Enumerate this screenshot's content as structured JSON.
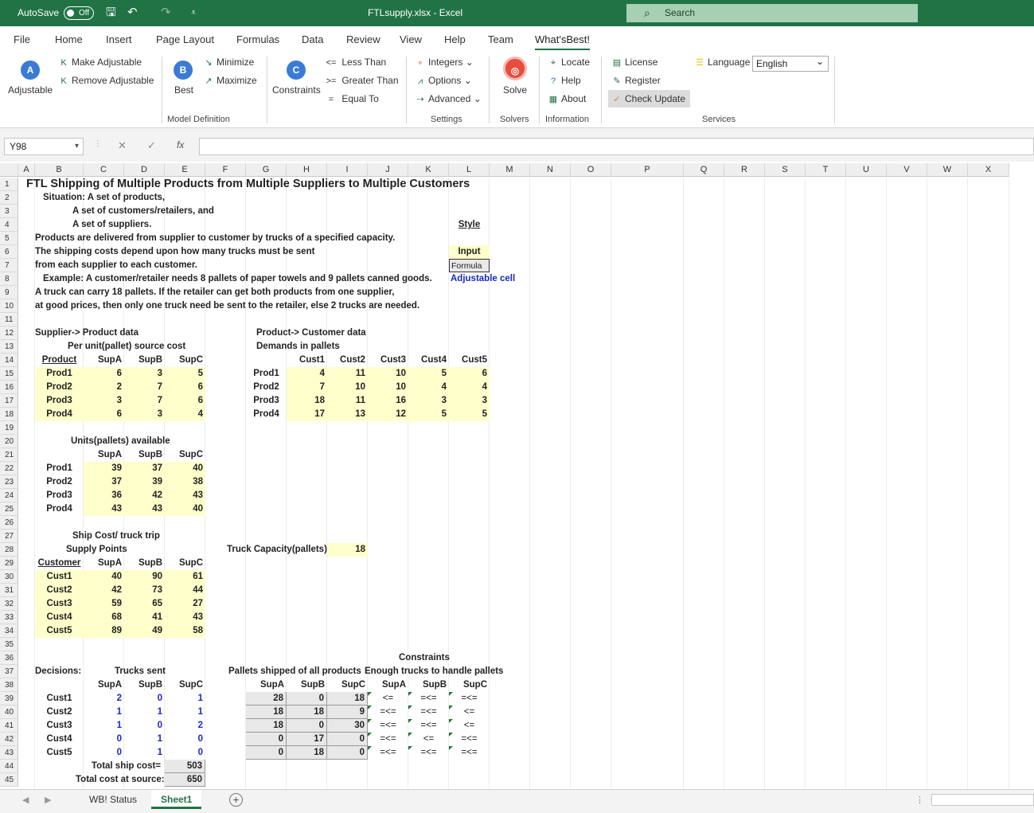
{
  "titlebar": {
    "autosave_label": "AutoSave",
    "autosave_state": "Off",
    "document_title": "FTLsupply.xlsx  -  Excel",
    "search_placeholder": "Search"
  },
  "tabs": [
    "File",
    "Home",
    "Insert",
    "Page Layout",
    "Formulas",
    "Data",
    "Review",
    "View",
    "Help",
    "Team",
    "What'sBest!"
  ],
  "ribbon": {
    "adjustable": "Adjustable",
    "make_adjustable": "Make Adjustable",
    "remove_adjustable": "Remove Adjustable",
    "best": "Best",
    "minimize": "Minimize",
    "maximize": "Maximize",
    "constraints": "Constraints",
    "less_than": "Less Than",
    "greater_than": "Greater Than",
    "equal_to": "Equal To",
    "integers": "Integers",
    "options": "Options",
    "advanced": "Advanced",
    "solve": "Solve",
    "locate": "Locate",
    "help": "Help",
    "about": "About",
    "license": "License",
    "register": "Register",
    "check_update": "Check Update",
    "language_label": "Language",
    "language_value": "English",
    "groups": {
      "model_definition": "Model Definition",
      "settings": "Settings",
      "solvers": "Solvers",
      "information": "Information",
      "services": "Services"
    }
  },
  "formula_bar": {
    "name_box": "Y98",
    "formula": ""
  },
  "columns": [
    "A",
    "B",
    "C",
    "D",
    "E",
    "F",
    "G",
    "H",
    "I",
    "J",
    "K",
    "L",
    "M",
    "N",
    "O",
    "P",
    "Q",
    "R",
    "S",
    "T",
    "U",
    "V",
    "W",
    "X"
  ],
  "cells": [
    {
      "r": 1,
      "c": "A",
      "t": "FTL Shipping of Multiple Products from Multiple Suppliers to Multiple Customers",
      "cls": "title"
    },
    {
      "r": 2,
      "c": "B",
      "t": "Situation: A set of products,",
      "o": 10
    },
    {
      "r": 3,
      "c": "C",
      "t": "A set of customers/retailers, and",
      "o": -14
    },
    {
      "r": 4,
      "c": "C",
      "t": "A set of  suppliers.",
      "o": -14
    },
    {
      "r": 4,
      "c": "L",
      "t": "Style",
      "cls": "u c"
    },
    {
      "r": 5,
      "c": "B",
      "t": "Products are delivered from supplier to customer by trucks of a specified capacity."
    },
    {
      "r": 6,
      "c": "B",
      "t": "The shipping costs depend upon how many trucks must be sent"
    },
    {
      "r": 6,
      "c": "L",
      "t": "Input",
      "cls": "c inp"
    },
    {
      "r": 7,
      "c": "B",
      "t": "from each supplier to each customer."
    },
    {
      "r": 7,
      "c": "L",
      "t": "Formula",
      "cls": "frm formula"
    },
    {
      "r": 8,
      "c": "B",
      "t": "Example: A customer/retailer needs 8 pallets of paper towels and 9 pallets canned goods.",
      "o": 10
    },
    {
      "r": 8,
      "c": "L",
      "t": "Adjustable cell",
      "cls": "blue"
    },
    {
      "r": 9,
      "c": "B",
      "t": "A truck can carry 18 pallets.  If the retailer can get both products from one supplier,"
    },
    {
      "r": 10,
      "c": "B",
      "t": "at good prices, then only one truck need be sent to the retailer, else 2 trucks are needed."
    },
    {
      "r": 12,
      "c": "B",
      "t": "Supplier-> Product data"
    },
    {
      "r": 12,
      "c": "H",
      "t": "Product-> Customer data",
      "o": -38
    },
    {
      "r": 13,
      "c": "C",
      "t": "Per unit(pallet) source cost",
      "o": -20
    },
    {
      "r": 13,
      "c": "H",
      "t": "Demands in pallets",
      "o": -38
    },
    {
      "r": 14,
      "c": "B",
      "t": "Product",
      "cls": "u c"
    },
    {
      "r": 14,
      "c": "C",
      "t": "SupA",
      "cls": "r"
    },
    {
      "r": 14,
      "c": "D",
      "t": "SupB",
      "cls": "r"
    },
    {
      "r": 14,
      "c": "E",
      "t": "SupC",
      "cls": "r"
    },
    {
      "r": 14,
      "c": "H",
      "t": "Cust1",
      "cls": "r"
    },
    {
      "r": 14,
      "c": "I",
      "t": "Cust2",
      "cls": "r"
    },
    {
      "r": 14,
      "c": "J",
      "t": "Cust3",
      "cls": "r"
    },
    {
      "r": 14,
      "c": "K",
      "t": "Cust4",
      "cls": "r"
    },
    {
      "r": 14,
      "c": "L",
      "t": "Cust5",
      "cls": "r"
    },
    {
      "r": 15,
      "c": "B",
      "t": "Prod1",
      "cls": "c inp"
    },
    {
      "r": 15,
      "c": "C",
      "t": "6",
      "cls": "r inp"
    },
    {
      "r": 15,
      "c": "D",
      "t": "3",
      "cls": "r inp"
    },
    {
      "r": 15,
      "c": "E",
      "t": "5",
      "cls": "r inp"
    },
    {
      "r": 16,
      "c": "B",
      "t": "Prod2",
      "cls": "c inp"
    },
    {
      "r": 16,
      "c": "C",
      "t": "2",
      "cls": "r inp"
    },
    {
      "r": 16,
      "c": "D",
      "t": "7",
      "cls": "r inp"
    },
    {
      "r": 16,
      "c": "E",
      "t": "6",
      "cls": "r inp"
    },
    {
      "r": 17,
      "c": "B",
      "t": "Prod3",
      "cls": "c inp"
    },
    {
      "r": 17,
      "c": "C",
      "t": "3",
      "cls": "r inp"
    },
    {
      "r": 17,
      "c": "D",
      "t": "7",
      "cls": "r inp"
    },
    {
      "r": 17,
      "c": "E",
      "t": "6",
      "cls": "r inp"
    },
    {
      "r": 18,
      "c": "B",
      "t": "Prod4",
      "cls": "c inp"
    },
    {
      "r": 18,
      "c": "C",
      "t": "6",
      "cls": "r inp"
    },
    {
      "r": 18,
      "c": "D",
      "t": "3",
      "cls": "r inp"
    },
    {
      "r": 18,
      "c": "E",
      "t": "4",
      "cls": "r inp"
    },
    {
      "r": 15,
      "c": "G",
      "t": "Prod1",
      "cls": "c"
    },
    {
      "r": 16,
      "c": "G",
      "t": "Prod2",
      "cls": "c"
    },
    {
      "r": 17,
      "c": "G",
      "t": "Prod3",
      "cls": "c"
    },
    {
      "r": 18,
      "c": "G",
      "t": "Prod4",
      "cls": "c"
    },
    {
      "r": 15,
      "c": "H",
      "t": "4",
      "cls": "r inp"
    },
    {
      "r": 15,
      "c": "I",
      "t": "11",
      "cls": "r inp"
    },
    {
      "r": 15,
      "c": "J",
      "t": "10",
      "cls": "r inp"
    },
    {
      "r": 15,
      "c": "K",
      "t": "5",
      "cls": "r inp"
    },
    {
      "r": 15,
      "c": "L",
      "t": "6",
      "cls": "r inp"
    },
    {
      "r": 16,
      "c": "H",
      "t": "7",
      "cls": "r inp"
    },
    {
      "r": 16,
      "c": "I",
      "t": "10",
      "cls": "r inp"
    },
    {
      "r": 16,
      "c": "J",
      "t": "10",
      "cls": "r inp"
    },
    {
      "r": 16,
      "c": "K",
      "t": "4",
      "cls": "r inp"
    },
    {
      "r": 16,
      "c": "L",
      "t": "4",
      "cls": "r inp"
    },
    {
      "r": 17,
      "c": "H",
      "t": "18",
      "cls": "r inp"
    },
    {
      "r": 17,
      "c": "I",
      "t": "11",
      "cls": "r inp"
    },
    {
      "r": 17,
      "c": "J",
      "t": "16",
      "cls": "r inp"
    },
    {
      "r": 17,
      "c": "K",
      "t": "3",
      "cls": "r inp"
    },
    {
      "r": 17,
      "c": "L",
      "t": "3",
      "cls": "r inp"
    },
    {
      "r": 18,
      "c": "H",
      "t": "17",
      "cls": "r inp"
    },
    {
      "r": 18,
      "c": "I",
      "t": "13",
      "cls": "r inp"
    },
    {
      "r": 18,
      "c": "J",
      "t": "12",
      "cls": "r inp"
    },
    {
      "r": 18,
      "c": "K",
      "t": "5",
      "cls": "r inp"
    },
    {
      "r": 18,
      "c": "L",
      "t": "5",
      "cls": "r inp"
    },
    {
      "r": 20,
      "c": "C",
      "t": "Units(pallets) available",
      "o": -16
    },
    {
      "r": 21,
      "c": "C",
      "t": "SupA",
      "cls": "r"
    },
    {
      "r": 21,
      "c": "D",
      "t": "SupB",
      "cls": "r"
    },
    {
      "r": 21,
      "c": "E",
      "t": "SupC",
      "cls": "r"
    },
    {
      "r": 22,
      "c": "B",
      "t": "Prod1",
      "cls": "c"
    },
    {
      "r": 22,
      "c": "C",
      "t": "39",
      "cls": "r inp"
    },
    {
      "r": 22,
      "c": "D",
      "t": "37",
      "cls": "r inp"
    },
    {
      "r": 22,
      "c": "E",
      "t": "40",
      "cls": "r inp"
    },
    {
      "r": 23,
      "c": "B",
      "t": "Prod2",
      "cls": "c"
    },
    {
      "r": 23,
      "c": "C",
      "t": "37",
      "cls": "r inp"
    },
    {
      "r": 23,
      "c": "D",
      "t": "39",
      "cls": "r inp"
    },
    {
      "r": 23,
      "c": "E",
      "t": "38",
      "cls": "r inp"
    },
    {
      "r": 24,
      "c": "B",
      "t": "Prod3",
      "cls": "c"
    },
    {
      "r": 24,
      "c": "C",
      "t": "36",
      "cls": "r inp"
    },
    {
      "r": 24,
      "c": "D",
      "t": "42",
      "cls": "r inp"
    },
    {
      "r": 24,
      "c": "E",
      "t": "43",
      "cls": "r inp"
    },
    {
      "r": 25,
      "c": "B",
      "t": "Prod4",
      "cls": "c"
    },
    {
      "r": 25,
      "c": "C",
      "t": "43",
      "cls": "r inp"
    },
    {
      "r": 25,
      "c": "D",
      "t": "43",
      "cls": "r inp"
    },
    {
      "r": 25,
      "c": "E",
      "t": "40",
      "cls": "r inp"
    },
    {
      "r": 27,
      "c": "C",
      "t": "Ship Cost/ truck trip",
      "o": -14
    },
    {
      "r": 28,
      "c": "C",
      "t": "Supply Points",
      "o": -22
    },
    {
      "r": 28,
      "c": "G",
      "t": "Truck Capacity(pallets):",
      "o": -24
    },
    {
      "r": 28,
      "c": "I",
      "t": "18",
      "cls": "r inp"
    },
    {
      "r": 29,
      "c": "B",
      "t": "Customer",
      "cls": "u c"
    },
    {
      "r": 29,
      "c": "C",
      "t": "SupA",
      "cls": "r"
    },
    {
      "r": 29,
      "c": "D",
      "t": "SupB",
      "cls": "r"
    },
    {
      "r": 29,
      "c": "E",
      "t": "SupC",
      "cls": "r"
    },
    {
      "r": 30,
      "c": "B",
      "t": "Cust1",
      "cls": "c inp"
    },
    {
      "r": 30,
      "c": "C",
      "t": "40",
      "cls": "r inp"
    },
    {
      "r": 30,
      "c": "D",
      "t": "90",
      "cls": "r inp"
    },
    {
      "r": 30,
      "c": "E",
      "t": "61",
      "cls": "r inp"
    },
    {
      "r": 31,
      "c": "B",
      "t": "Cust2",
      "cls": "c inp"
    },
    {
      "r": 31,
      "c": "C",
      "t": "42",
      "cls": "r inp"
    },
    {
      "r": 31,
      "c": "D",
      "t": "73",
      "cls": "r inp"
    },
    {
      "r": 31,
      "c": "E",
      "t": "44",
      "cls": "r inp"
    },
    {
      "r": 32,
      "c": "B",
      "t": "Cust3",
      "cls": "c inp"
    },
    {
      "r": 32,
      "c": "C",
      "t": "59",
      "cls": "r inp"
    },
    {
      "r": 32,
      "c": "D",
      "t": "65",
      "cls": "r inp"
    },
    {
      "r": 32,
      "c": "E",
      "t": "27",
      "cls": "r inp"
    },
    {
      "r": 33,
      "c": "B",
      "t": "Cust4",
      "cls": "c inp"
    },
    {
      "r": 33,
      "c": "C",
      "t": "68",
      "cls": "r inp"
    },
    {
      "r": 33,
      "c": "D",
      "t": "41",
      "cls": "r inp"
    },
    {
      "r": 33,
      "c": "E",
      "t": "43",
      "cls": "r inp"
    },
    {
      "r": 34,
      "c": "B",
      "t": "Cust5",
      "cls": "c inp"
    },
    {
      "r": 34,
      "c": "C",
      "t": "89",
      "cls": "r inp"
    },
    {
      "r": 34,
      "c": "D",
      "t": "49",
      "cls": "r inp"
    },
    {
      "r": 34,
      "c": "E",
      "t": "58",
      "cls": "r inp"
    },
    {
      "r": 36,
      "c": "K",
      "t": "Constraints",
      "o": -12
    },
    {
      "r": 37,
      "c": "B",
      "t": "Decisions:"
    },
    {
      "r": 37,
      "c": "D",
      "t": "Trucks sent",
      "o": -12
    },
    {
      "r": 37,
      "c": "G",
      "t": "Pallets shipped of all products",
      "o": -22
    },
    {
      "r": 37,
      "c": "J",
      "t": "Enough trucks to handle pallets",
      "o": -4
    },
    {
      "r": 38,
      "c": "C",
      "t": "SupA",
      "cls": "r"
    },
    {
      "r": 38,
      "c": "D",
      "t": "SupB",
      "cls": "r"
    },
    {
      "r": 38,
      "c": "E",
      "t": "SupC",
      "cls": "r"
    },
    {
      "r": 38,
      "c": "G",
      "t": "SupA",
      "cls": "r"
    },
    {
      "r": 38,
      "c": "H",
      "t": "SupB",
      "cls": "r"
    },
    {
      "r": 38,
      "c": "I",
      "t": "SupC",
      "cls": "r"
    },
    {
      "r": 38,
      "c": "J",
      "t": "SupA",
      "cls": "r"
    },
    {
      "r": 38,
      "c": "K",
      "t": "SupB",
      "cls": "r"
    },
    {
      "r": 38,
      "c": "L",
      "t": "SupC",
      "cls": "r"
    },
    {
      "r": 39,
      "c": "B",
      "t": "Cust1",
      "cls": "c"
    },
    {
      "r": 39,
      "c": "C",
      "t": "2",
      "cls": "r blue"
    },
    {
      "r": 39,
      "c": "D",
      "t": "0",
      "cls": "r blue"
    },
    {
      "r": 39,
      "c": "E",
      "t": "1",
      "cls": "r blue"
    },
    {
      "r": 40,
      "c": "B",
      "t": "Cust2",
      "cls": "c"
    },
    {
      "r": 40,
      "c": "C",
      "t": "1",
      "cls": "r blue"
    },
    {
      "r": 40,
      "c": "D",
      "t": "1",
      "cls": "r blue"
    },
    {
      "r": 40,
      "c": "E",
      "t": "1",
      "cls": "r blue"
    },
    {
      "r": 41,
      "c": "B",
      "t": "Cust3",
      "cls": "c"
    },
    {
      "r": 41,
      "c": "C",
      "t": "1",
      "cls": "r blue"
    },
    {
      "r": 41,
      "c": "D",
      "t": "0",
      "cls": "r blue"
    },
    {
      "r": 41,
      "c": "E",
      "t": "2",
      "cls": "r blue"
    },
    {
      "r": 42,
      "c": "B",
      "t": "Cust4",
      "cls": "c"
    },
    {
      "r": 42,
      "c": "C",
      "t": "0",
      "cls": "r blue"
    },
    {
      "r": 42,
      "c": "D",
      "t": "1",
      "cls": "r blue"
    },
    {
      "r": 42,
      "c": "E",
      "t": "0",
      "cls": "r blue"
    },
    {
      "r": 43,
      "c": "B",
      "t": "Cust5",
      "cls": "c"
    },
    {
      "r": 43,
      "c": "C",
      "t": "0",
      "cls": "r blue"
    },
    {
      "r": 43,
      "c": "D",
      "t": "1",
      "cls": "r blue"
    },
    {
      "r": 43,
      "c": "E",
      "t": "0",
      "cls": "r blue"
    },
    {
      "r": 39,
      "c": "G",
      "t": "28",
      "cls": "r frm"
    },
    {
      "r": 39,
      "c": "H",
      "t": "0",
      "cls": "r frm"
    },
    {
      "r": 39,
      "c": "I",
      "t": "18",
      "cls": "r frm"
    },
    {
      "r": 40,
      "c": "G",
      "t": "18",
      "cls": "r frm"
    },
    {
      "r": 40,
      "c": "H",
      "t": "18",
      "cls": "r frm"
    },
    {
      "r": 40,
      "c": "I",
      "t": "9",
      "cls": "r frm"
    },
    {
      "r": 41,
      "c": "G",
      "t": "18",
      "cls": "r frm"
    },
    {
      "r": 41,
      "c": "H",
      "t": "0",
      "cls": "r frm"
    },
    {
      "r": 41,
      "c": "I",
      "t": "30",
      "cls": "r frm"
    },
    {
      "r": 42,
      "c": "G",
      "t": "0",
      "cls": "r frm"
    },
    {
      "r": 42,
      "c": "H",
      "t": "17",
      "cls": "r frm"
    },
    {
      "r": 42,
      "c": "I",
      "t": "0",
      "cls": "r frm"
    },
    {
      "r": 43,
      "c": "G",
      "t": "0",
      "cls": "r frm"
    },
    {
      "r": 43,
      "c": "H",
      "t": "18",
      "cls": "r frm"
    },
    {
      "r": 43,
      "c": "I",
      "t": "0",
      "cls": "r frm"
    },
    {
      "r": 39,
      "c": "J",
      "t": "<=",
      "cls": "c tri"
    },
    {
      "r": 39,
      "c": "K",
      "t": "=<=",
      "cls": "c tri"
    },
    {
      "r": 39,
      "c": "L",
      "t": "=<=",
      "cls": "c tri"
    },
    {
      "r": 40,
      "c": "J",
      "t": "=<=",
      "cls": "c tri"
    },
    {
      "r": 40,
      "c": "K",
      "t": "=<=",
      "cls": "c tri"
    },
    {
      "r": 40,
      "c": "L",
      "t": "<=",
      "cls": "c tri"
    },
    {
      "r": 41,
      "c": "J",
      "t": "=<=",
      "cls": "c tri"
    },
    {
      "r": 41,
      "c": "K",
      "t": "=<=",
      "cls": "c tri"
    },
    {
      "r": 41,
      "c": "L",
      "t": "<=",
      "cls": "c tri"
    },
    {
      "r": 42,
      "c": "J",
      "t": "=<=",
      "cls": "c tri"
    },
    {
      "r": 42,
      "c": "K",
      "t": "<=",
      "cls": "c tri"
    },
    {
      "r": 42,
      "c": "L",
      "t": "=<=",
      "cls": "c tri"
    },
    {
      "r": 43,
      "c": "J",
      "t": "=<=",
      "cls": "c tri"
    },
    {
      "r": 43,
      "c": "K",
      "t": "=<=",
      "cls": "c tri"
    },
    {
      "r": 43,
      "c": "L",
      "t": "=<=",
      "cls": "c tri"
    },
    {
      "r": 44,
      "c": "C",
      "t": "Total ship cost=",
      "o": 10
    },
    {
      "r": 44,
      "c": "E",
      "t": "503",
      "cls": "r frm"
    },
    {
      "r": 45,
      "c": "C",
      "t": "Total cost at source:",
      "o": -10
    },
    {
      "r": 45,
      "c": "E",
      "t": "650",
      "cls": "r frm"
    }
  ],
  "sheet_tabs": [
    "WB! Status",
    "Sheet1"
  ],
  "active_sheet": "Sheet1",
  "colors": {
    "excel_green": "#217346",
    "input_yellow": "#ffffcc",
    "adjustable_blue": "#1a28c4"
  }
}
